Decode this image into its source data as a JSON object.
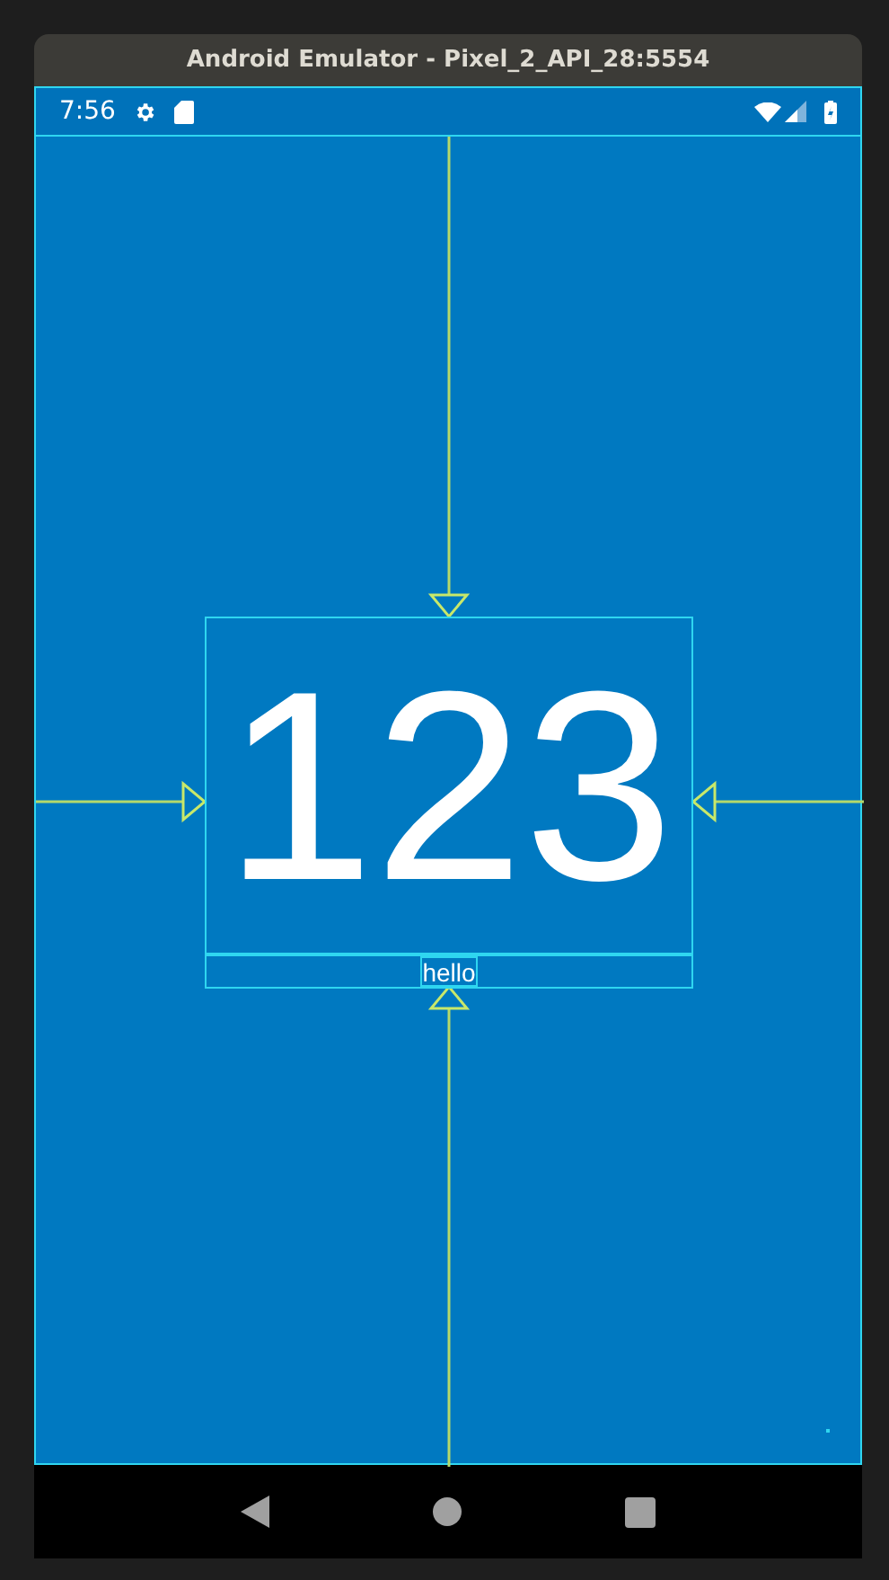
{
  "window": {
    "title": "Android Emulator - Pixel_2_API_28:5554"
  },
  "status_bar": {
    "time": "7:56"
  },
  "screen": {
    "number_text": "123",
    "caption": "hello"
  }
}
